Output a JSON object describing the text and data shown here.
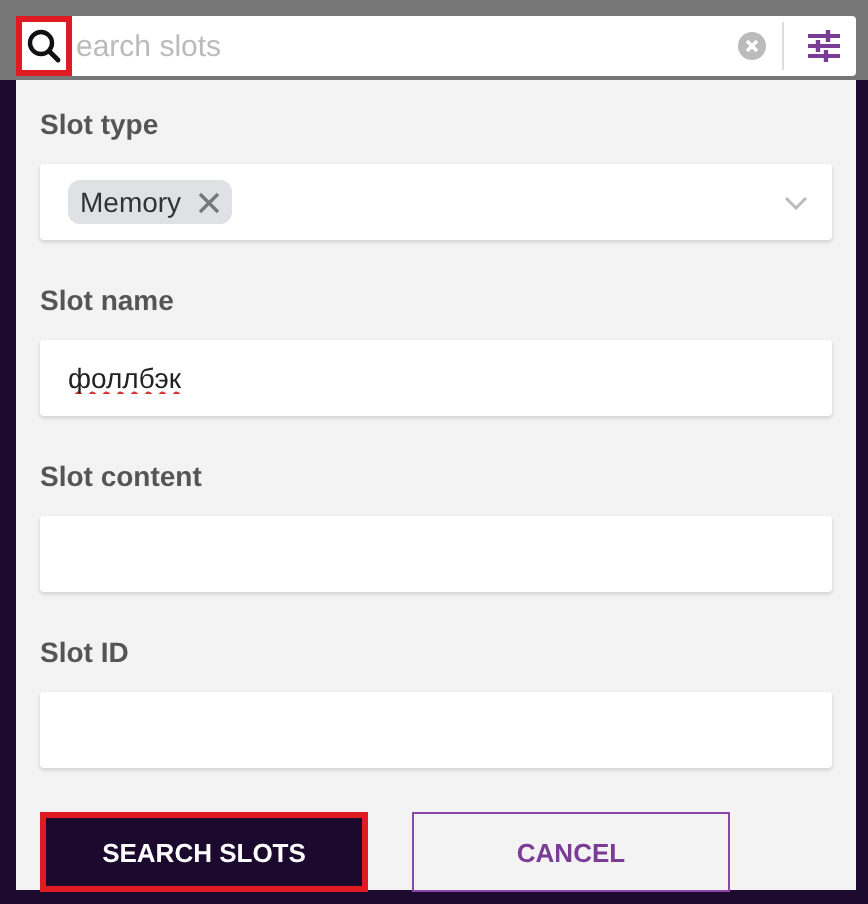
{
  "search": {
    "placeholder": "earch slots",
    "highlighted": true
  },
  "fields": [
    {
      "kind": "select",
      "label": "Slot type",
      "chips": [
        "Memory"
      ]
    },
    {
      "kind": "text",
      "label": "Slot name",
      "value": "фоллбэк"
    },
    {
      "kind": "text",
      "label": "Slot content"
    },
    {
      "kind": "text",
      "label": "Slot ID"
    }
  ],
  "buttons": [
    {
      "kind": "primary",
      "label": "SEARCH SLOTS",
      "highlighted": true
    },
    {
      "kind": "outline",
      "label": "CANCEL",
      "highlighted": false
    }
  ]
}
